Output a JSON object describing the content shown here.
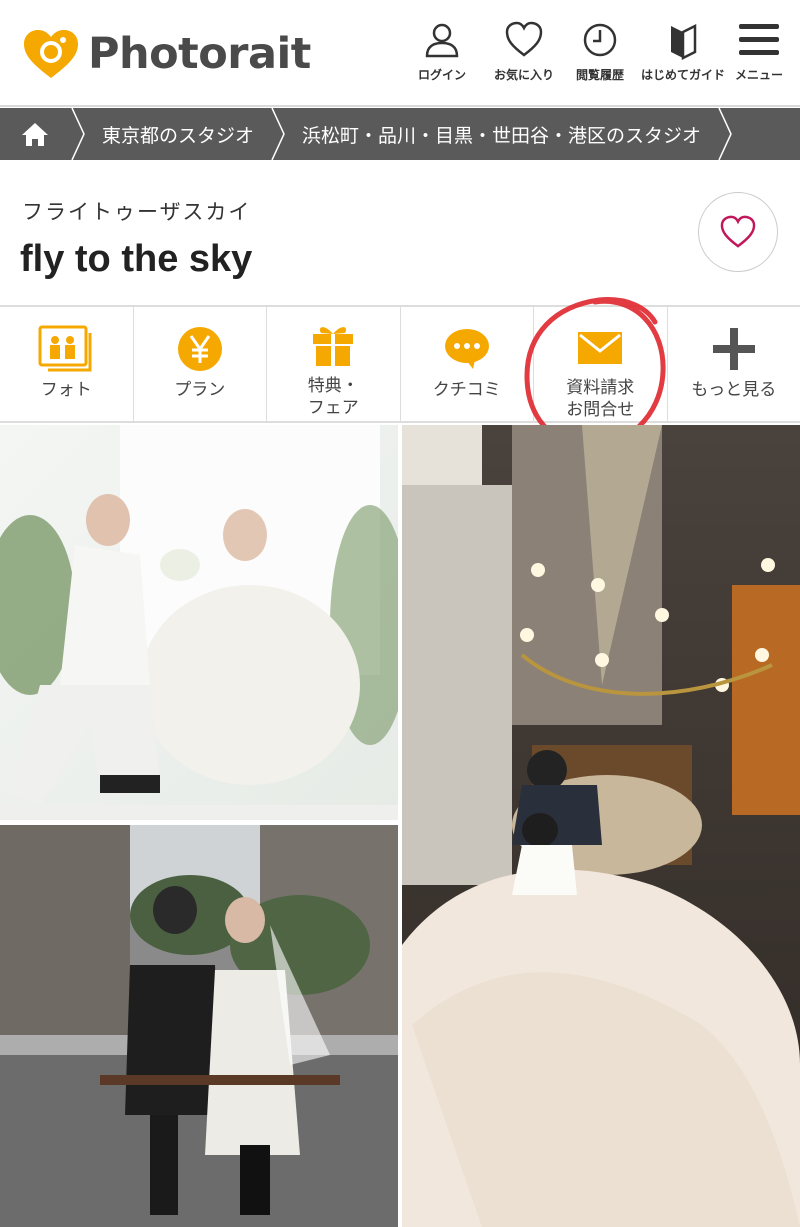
{
  "app": {
    "logo_text": "Photorait",
    "accent": "#f5a800"
  },
  "nav": [
    {
      "label": "ログイン",
      "icon": "user-icon"
    },
    {
      "label": "お気に入り",
      "icon": "heart-icon"
    },
    {
      "label": "閲覧履歴",
      "icon": "clock-icon"
    },
    {
      "label": "はじめてガイド",
      "icon": "beginner-icon"
    },
    {
      "label": "メニュー",
      "icon": "menu-icon"
    }
  ],
  "breadcrumb": {
    "home_icon": "home-icon",
    "items": [
      "東京都のスタジオ",
      "浜松町・品川・目黒・世田谷・港区のスタジオ"
    ]
  },
  "studio": {
    "kana": "フライトゥーザスカイ",
    "name": "fly to the sky",
    "favorite_icon": "heart-outline-icon"
  },
  "tabs": [
    {
      "label": "フォト",
      "icon": "photo-icon"
    },
    {
      "label": "プラン",
      "icon": "yen-icon"
    },
    {
      "label": "特典・\nフェア",
      "icon": "gift-icon"
    },
    {
      "label": "クチコミ",
      "icon": "chat-icon"
    },
    {
      "label": "資料請求\nお問合せ",
      "icon": "mail-icon"
    },
    {
      "label": "もっと見る",
      "icon": "plus-icon"
    }
  ],
  "colors": {
    "breadcrumb_bg": "#5a5a5a",
    "annotation_circle": "#e0262e",
    "tab_icon": "#f5a800"
  }
}
